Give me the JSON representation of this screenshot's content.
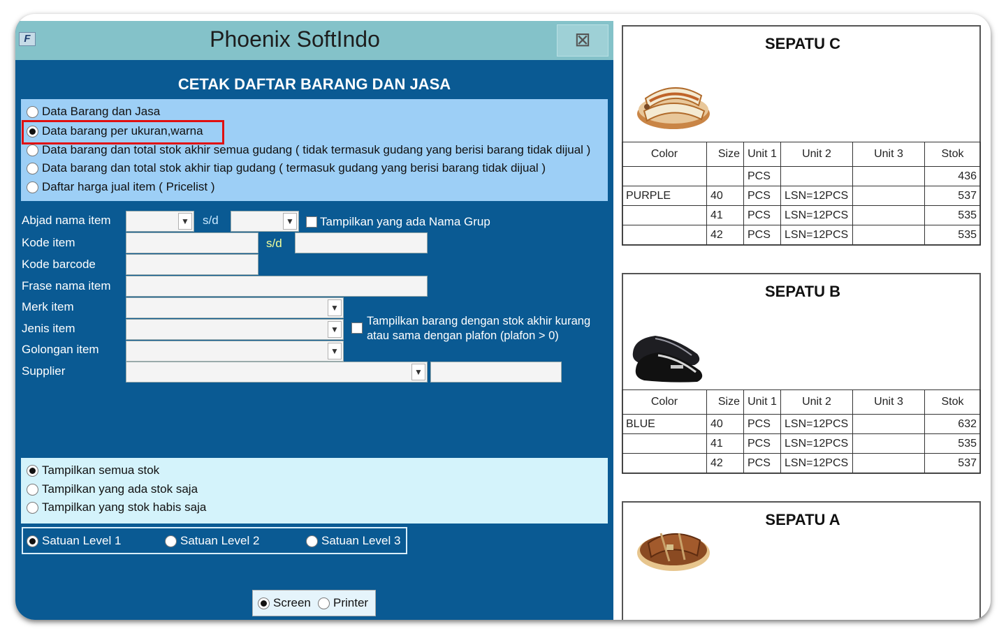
{
  "window": {
    "title": "Phoenix SoftIndo",
    "logo": "F",
    "close": "⊠"
  },
  "heading": "CETAK DAFTAR BARANG DAN JASA",
  "report_types": [
    {
      "label": "Data Barang dan Jasa",
      "selected": false
    },
    {
      "label": "Data barang per ukuran,warna",
      "selected": true
    },
    {
      "label": "Data barang dan total stok akhir semua gudang ( tidak termasuk gudang yang berisi barang tidak dijual )",
      "selected": false
    },
    {
      "label": "Data barang dan total stok akhir tiap gudang ( termasuk gudang yang berisi barang tidak dijual )",
      "selected": false
    },
    {
      "label": "Daftar harga jual item ( Pricelist )",
      "selected": false
    }
  ],
  "filters": {
    "abjad_label": "Abjad nama item",
    "sd_label": "s/d",
    "sd_label2": "s/d",
    "show_group_label": "Tampilkan yang ada Nama Grup",
    "kode_item_label": "Kode item",
    "kode_barcode_label": "Kode barcode",
    "frase_label": "Frase nama item",
    "merk_label": "Merk item",
    "jenis_label": "Jenis item",
    "golongan_label": "Golongan item",
    "supplier_label": "Supplier",
    "plafon_label_line1": "Tampilkan barang dengan stok akhir kurang",
    "plafon_label_line2": "atau sama dengan plafon (plafon > 0)"
  },
  "stock_options": [
    {
      "label": "Tampilkan semua stok",
      "selected": true
    },
    {
      "label": "Tampilkan yang ada stok saja",
      "selected": false
    },
    {
      "label": "Tampilkan yang stok habis saja",
      "selected": false
    }
  ],
  "unit_levels": [
    {
      "label": "Satuan Level 1",
      "selected": true
    },
    {
      "label": "Satuan Level 2",
      "selected": false
    },
    {
      "label": "Satuan Level 3",
      "selected": false
    }
  ],
  "output": [
    {
      "label": "Screen",
      "selected": true
    },
    {
      "label": "Printer",
      "selected": false
    }
  ],
  "report": {
    "columns": [
      "Color",
      "Size",
      "Unit 1",
      "Unit 2",
      "Unit 3",
      "Stok"
    ],
    "products": [
      {
        "name": "SEPATU C",
        "image": "sandal-cream-icon",
        "rows": [
          [
            "",
            "",
            "PCS",
            "",
            "",
            "436"
          ],
          [
            "PURPLE",
            "40",
            "PCS",
            "LSN=12PCS",
            "",
            "537"
          ],
          [
            "",
            "41",
            "PCS",
            "LSN=12PCS",
            "",
            "535"
          ],
          [
            "",
            "42",
            "PCS",
            "LSN=12PCS",
            "",
            "535"
          ]
        ]
      },
      {
        "name": "SEPATU B",
        "image": "loafer-black-icon",
        "rows": [
          [
            "BLUE",
            "40",
            "PCS",
            "LSN=12PCS",
            "",
            "632"
          ],
          [
            "",
            "41",
            "PCS",
            "LSN=12PCS",
            "",
            "535"
          ],
          [
            "",
            "42",
            "PCS",
            "LSN=12PCS",
            "",
            "537"
          ]
        ]
      },
      {
        "name": "SEPATU A",
        "image": "sandal-brown-icon",
        "rows": []
      }
    ]
  },
  "colors": {
    "window_bg": "#0a5a93",
    "titlebar": "#84c2c9",
    "panel": "#9dcff6",
    "highlight": "#e01010"
  }
}
